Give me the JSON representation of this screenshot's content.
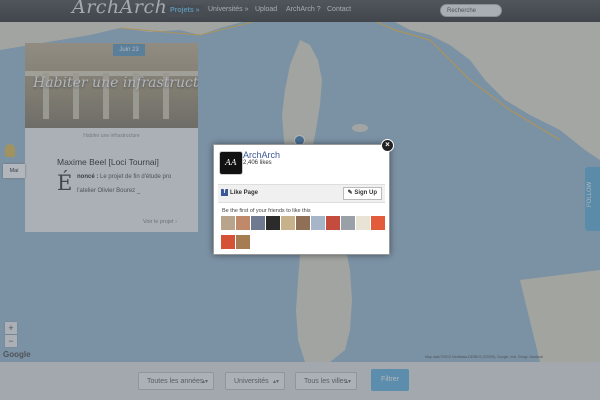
{
  "nav": {
    "brand": "ArchArch",
    "items": [
      {
        "label": "Projets »",
        "active": true
      },
      {
        "label": "Universités »",
        "active": false
      },
      {
        "label": "Upload",
        "active": false
      },
      {
        "label": "ArchArch ?",
        "active": false
      },
      {
        "label": "Contact",
        "active": false
      }
    ],
    "search_placeholder": "Recherche"
  },
  "card": {
    "date": "Juin 23",
    "image_title": "Habiter une infrastructure",
    "image_caption": "Habiter une infrastructure",
    "author": "Maxime Beel [Loci Tournai]",
    "dropcap": "É",
    "excerpt_bold": "noncé :",
    "excerpt_line1": " Le projet de fin d'étude pro",
    "excerpt_line2": "l'atelier Olivier Bourez _",
    "more_label": "Voir le projet  ›"
  },
  "map": {
    "maptype_label": "Mai",
    "zoom_in": "+",
    "zoom_out": "−",
    "google_label": "Google",
    "credits": "Map data ©2013 GeoBasis-DE/BKG (©2009), Google, Inst. Geogr. Nacional",
    "side_tab_label": "FOLLOW"
  },
  "filters": {
    "years": "Toutes les années",
    "universities": "Universités",
    "cities": "Tous les villes",
    "button": "Filtrer"
  },
  "facebook": {
    "logo_text": "AA",
    "page_name": "ArchArch",
    "likes": "2,406 likes",
    "like_page": "Like Page",
    "sign_up": "Sign Up",
    "first_friends": "Be the first of your friends to like this",
    "close": "×",
    "friend_colors": [
      "#b8a48a",
      "#c08a6a",
      "#6f7a90",
      "#2b2b2b",
      "#c7b28c",
      "#8f6f55",
      "#a7b5c9",
      "#c44c3f",
      "#9aa0a8",
      "#e8e3d5",
      "#e25b3b",
      "#d65236",
      "#a67c52"
    ]
  }
}
